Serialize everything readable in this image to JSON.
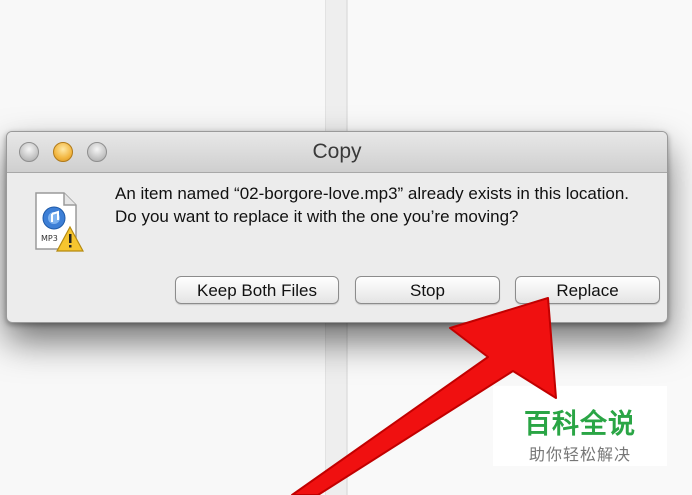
{
  "window": {
    "title": "Copy"
  },
  "dialog": {
    "message": "An item named “02-borgore-love.mp3” already exists in this location. Do you want to replace it with the one you’re moving?",
    "file_icon": "mp3-file-warning-icon",
    "buttons": {
      "keep_both": "Keep Both Files",
      "stop": "Stop",
      "replace": "Replace"
    }
  },
  "watermark": {
    "title": "百科全说",
    "subtitle": "助你轻松解决"
  },
  "colors": {
    "arrow": "#f01010",
    "watermark_green": "#2aa545",
    "minimize_light": "#f2b640"
  }
}
